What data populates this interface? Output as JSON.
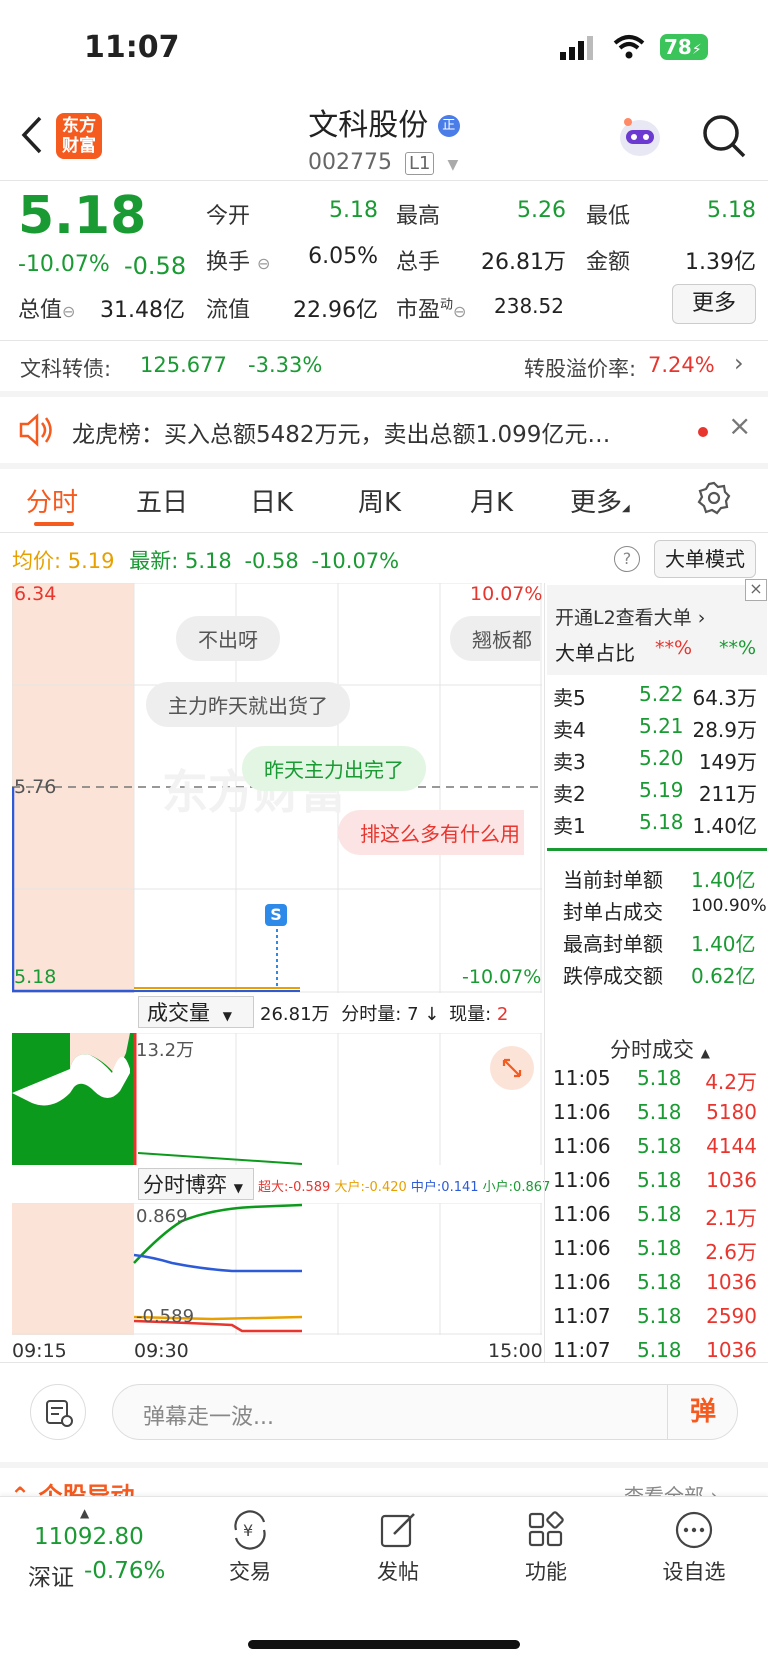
{
  "status": {
    "time": "11:07",
    "battery": "78"
  },
  "header": {
    "logo_line1": "东方",
    "logo_line2": "财富",
    "stock_name": "文科股份",
    "stock_code": "002775",
    "level": "L1"
  },
  "quote": {
    "price": "5.18",
    "change_pct": "-10.07%",
    "change": "-0.58",
    "open_label": "今开",
    "open": "5.18",
    "high_label": "最高",
    "high": "5.26",
    "low_label": "最低",
    "low": "5.18",
    "turnover_label": "换手",
    "turnover": "6.05%",
    "volume_label": "总手",
    "volume": "26.81万",
    "amount_label": "金额",
    "amount": "1.39亿",
    "mktcap_label": "总值",
    "mktcap": "31.48亿",
    "float_label": "流值",
    "float_cap": "22.96亿",
    "pe_label": "市盈",
    "pe_sup": "动",
    "pe": "238.52",
    "more_button": "更多"
  },
  "bond": {
    "label": "文科转债:",
    "price": "125.677",
    "change": "-3.33%",
    "premium_label": "转股溢价率:",
    "premium": "7.24%"
  },
  "notice": {
    "text": "龙虎榜：买入总额5482万元，卖出总额1.099亿元…"
  },
  "tabs": [
    "分时",
    "五日",
    "日K",
    "周K",
    "月K",
    "更多"
  ],
  "chart_header": {
    "avg_label": "均价:",
    "avg": "5.19",
    "latest_label": "最新:",
    "latest": "5.18",
    "change": "-0.58",
    "change_pct": "-10.07%",
    "big_order_button": "大单模式"
  },
  "chart_labels": {
    "high": "6.34",
    "high_pct": "10.07%",
    "mid": "5.76",
    "low": "5.18",
    "low_pct": "-10.07%",
    "marker": "S"
  },
  "danmaku": [
    "不出呀",
    "翘板都",
    "主力昨天就出货了",
    "昨天主力出完了",
    "排这么多有什么用"
  ],
  "volume_bar": {
    "selector": "成交量",
    "total": "26.81万",
    "fenshi_label": "分时量:",
    "fenshi": "7",
    "arrow": "↓",
    "now_label": "现量:",
    "now": "2",
    "max": "13.2万"
  },
  "game_bar": {
    "selector": "分时博弈",
    "super_label": "超大:",
    "super": "-0.589",
    "big_label": "大户:",
    "big": "-0.420",
    "mid_label": "中户:",
    "mid": "0.141",
    "small_label": "小户:",
    "small": "0.867",
    "top": "0.869",
    "bottom": "-0.589"
  },
  "time_axis": [
    "09:15",
    "09:30",
    "15:00"
  ],
  "orderbook": {
    "l2_link": "开通L2查看大单",
    "ratio_label": "大单占比",
    "ratio1": "**%",
    "ratio2": "**%",
    "asks": [
      {
        "label": "卖5",
        "price": "5.22",
        "vol": "64.3万"
      },
      {
        "label": "卖4",
        "price": "5.21",
        "vol": "28.9万"
      },
      {
        "label": "卖3",
        "price": "5.20",
        "vol": "149万"
      },
      {
        "label": "卖2",
        "price": "5.19",
        "vol": "211万"
      },
      {
        "label": "卖1",
        "price": "5.18",
        "vol": "1.40亿"
      }
    ],
    "seal": [
      {
        "label": "当前封单额",
        "value": "1.40亿"
      },
      {
        "label": "封单占成交",
        "value": "100.90%"
      },
      {
        "label": "最高封单额",
        "value": "1.40亿"
      },
      {
        "label": "跌停成交额",
        "value": "0.62亿"
      }
    ],
    "trades_title": "分时成交",
    "trades": [
      {
        "time": "11:05",
        "price": "5.18",
        "vol": "4.2万"
      },
      {
        "time": "11:06",
        "price": "5.18",
        "vol": "5180"
      },
      {
        "time": "11:06",
        "price": "5.18",
        "vol": "4144"
      },
      {
        "time": "11:06",
        "price": "5.18",
        "vol": "1036"
      },
      {
        "time": "11:06",
        "price": "5.18",
        "vol": "2.1万"
      },
      {
        "time": "11:06",
        "price": "5.18",
        "vol": "2.6万"
      },
      {
        "time": "11:06",
        "price": "5.18",
        "vol": "1036"
      },
      {
        "time": "11:07",
        "price": "5.18",
        "vol": "2590"
      },
      {
        "time": "11:07",
        "price": "5.18",
        "vol": "1036"
      }
    ]
  },
  "comment": {
    "placeholder": "弹幕走一波...",
    "send": "弹"
  },
  "section_partial": {
    "title": "个股异动",
    "link": "查看全部"
  },
  "bottom_nav": {
    "index_value": "11092.80",
    "index_name": "深证",
    "index_change": "-0.76%",
    "items": [
      "交易",
      "发帖",
      "功能",
      "设自选"
    ]
  },
  "colors": {
    "up": "#e8352e",
    "down": "#1a9a33",
    "accent": "#f55a1e",
    "premarket": "#fbe3d8"
  }
}
